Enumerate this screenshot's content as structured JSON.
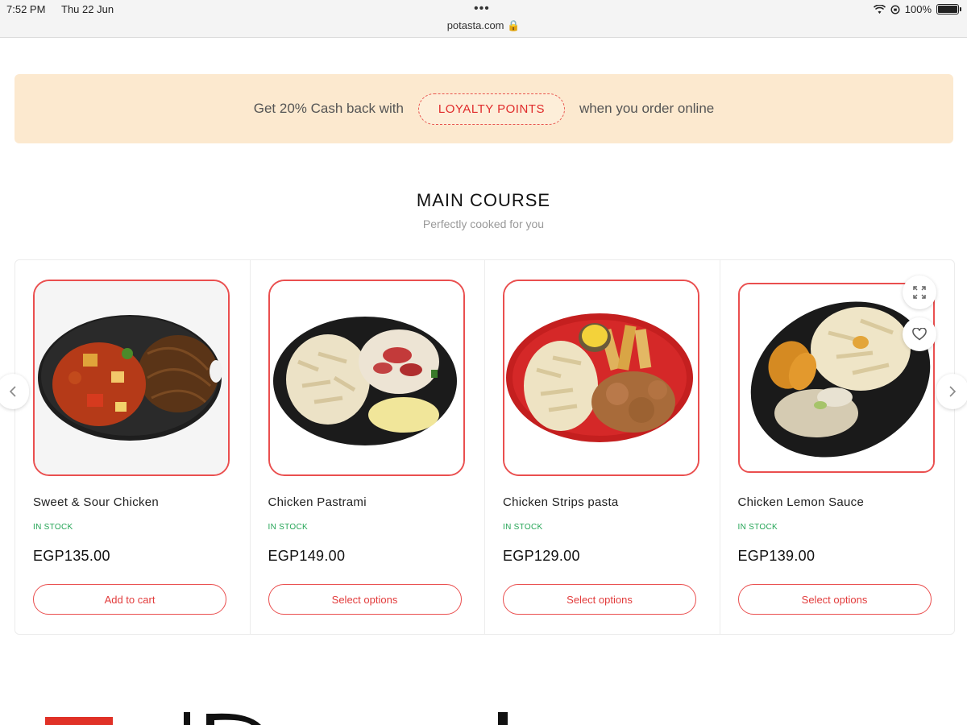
{
  "status_bar": {
    "time": "7:52 PM",
    "date": "Thu 22 Jun",
    "dots": "•••",
    "url": "potasta.com 🔒",
    "battery": "100%"
  },
  "promo": {
    "before": "Get 20% Cash back with",
    "badge": "LOYALTY POINTS",
    "after": "when you order online",
    "bg_color": "#fce9cf",
    "accent": "#e02b2b"
  },
  "section": {
    "title": "MAIN COURSE",
    "subtitle": "Perfectly cooked for you"
  },
  "products": [
    {
      "name": "Sweet & Sour Chicken",
      "stock": "IN STOCK",
      "price": "EGP135.00",
      "cta": "Add to cart"
    },
    {
      "name": "Chicken Pastrami",
      "stock": "IN STOCK",
      "price": "EGP149.00",
      "cta": "Select options"
    },
    {
      "name": "Chicken Strips pasta",
      "stock": "IN STOCK",
      "price": "EGP129.00",
      "cta": "Select options"
    },
    {
      "name": "Chicken Lemon Sauce",
      "stock": "IN STOCK",
      "price": "EGP139.00",
      "cta": "Select options"
    }
  ],
  "icons": {
    "prev": "chevron-left-icon",
    "next": "chevron-right-icon",
    "expand": "expand-icon",
    "wishlist": "heart-icon"
  },
  "colors": {
    "brand_red": "#ea4f4f",
    "stock_green": "#23a455"
  }
}
